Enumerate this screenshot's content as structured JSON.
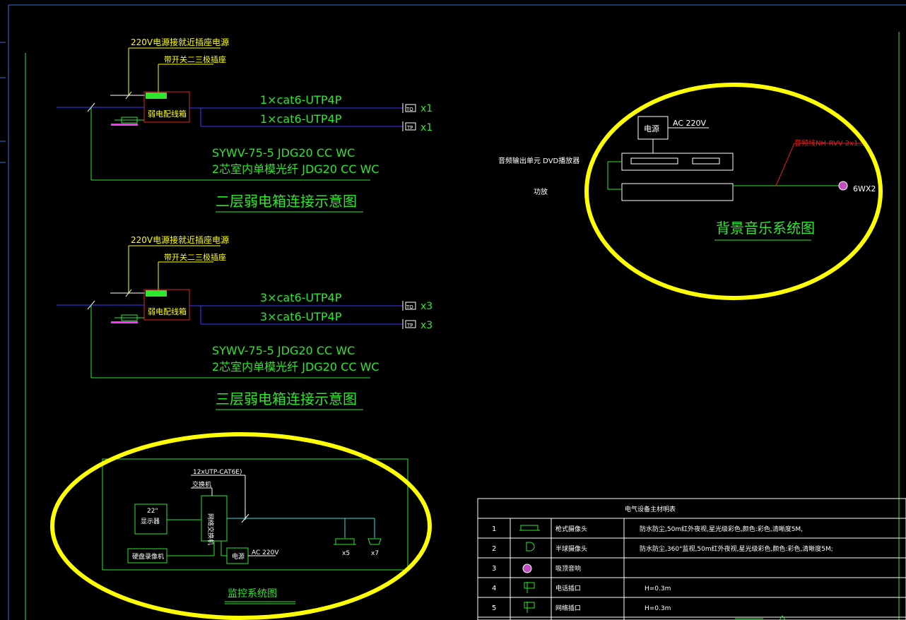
{
  "floor2": {
    "power_note": "220V电源接就近插座电源",
    "socket_note": "带开关二三极插座",
    "box_label": "弱电配线箱",
    "cable1": "1×cat6-UTP4P",
    "cable2": "1×cat6-UTP4P",
    "count1": "x1",
    "count2": "x1",
    "spec1": "SYWV-75-5   JDG20 CC WC",
    "spec2": "2芯室内单模光纤  JDG20 CC WC",
    "title": "二层弱电箱连接示意图",
    "jack1": "TO",
    "jack2": "TP"
  },
  "floor3": {
    "power_note": "220V电源接就近插座电源",
    "socket_note": "带开关二三极插座",
    "box_label": "弱电配线箱",
    "cable1": "3×cat6-UTP4P",
    "cable2": "3×cat6-UTP4P",
    "count1": "x3",
    "count2": "x3",
    "spec1": "SYWV-75-5   JDG20 CC WC",
    "spec2": "2芯室内单模光纤  JDG20 CC WC",
    "title": "三层弱电箱连接示意图",
    "jack1": "TO",
    "jack2": "TP"
  },
  "music": {
    "power_label": "电源",
    "ac": "AC 220V",
    "player_label": "音频输出单元 DVD播放器",
    "amp_label": "功放",
    "cable_red": "音频线NH-RVV-2x1.5",
    "speaker_count": "6WX2",
    "title": "背景音乐系统图"
  },
  "cctv": {
    "cable": "12xUTP-CAT6E)",
    "switch_label": "交换机",
    "monitor_size": "22\"",
    "monitor_label": "显示器",
    "nvr_label": "硬盘录像机",
    "poe_label": "网络交换机",
    "power_label": "电源",
    "ac": "AC 220V",
    "count_a": "x5",
    "count_b": "x7",
    "title": "监控系统图"
  },
  "legend": {
    "title": "电气设备主材明表",
    "rows": [
      {
        "no": "1",
        "name": "枪式摄像头",
        "desc": "防水防尘,50m红外夜视,星光级彩色,颜色:彩色,清晰度5M,"
      },
      {
        "no": "2",
        "name": "半球摄像头",
        "desc": "防水防尘,360°监视,50m红外夜视,星光级彩色,颜色:彩色,清晰度5M;"
      },
      {
        "no": "3",
        "name": "吸顶音响",
        "desc": ""
      },
      {
        "no": "4",
        "name": "电话插口",
        "desc": "H=0.3m"
      },
      {
        "no": "5",
        "name": "网络插口",
        "desc": "H=0.3m"
      }
    ]
  },
  "colors": {
    "green": "#2ee62e",
    "blue": "#3a3aff",
    "red": "#e02020",
    "yellow": "#ffff00",
    "cyan": "#33e0e0",
    "white": "#ffffff",
    "magenta": "#ff33ff"
  }
}
